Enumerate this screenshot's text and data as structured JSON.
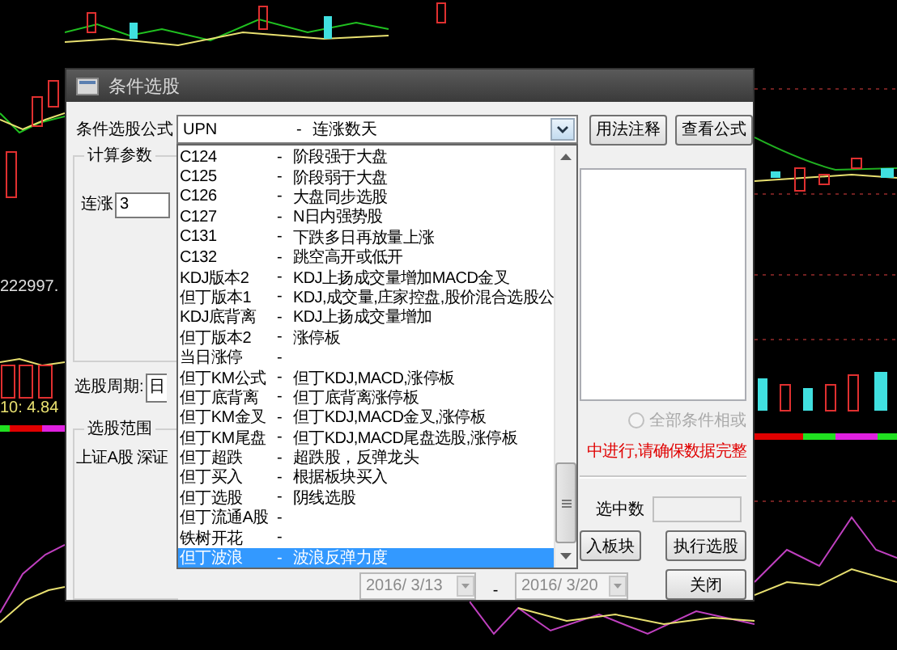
{
  "chart_left": {
    "price_label": "222997.",
    "indicator_label": "10: 4.84"
  },
  "dialog": {
    "title": "条件选股",
    "formula_label": "条件选股公式",
    "formula_combo": {
      "code": "UPN",
      "separator": "-",
      "name": "连涨数天"
    },
    "buttons_top": [
      "用法注释",
      "查看公式"
    ],
    "dropdown_items": [
      {
        "code": "C124",
        "dash": "-",
        "desc": "阶段强于大盘",
        "selected": false
      },
      {
        "code": "C125",
        "dash": "-",
        "desc": "阶段弱于大盘",
        "selected": false
      },
      {
        "code": "C126",
        "dash": "-",
        "desc": "大盘同步选股",
        "selected": false
      },
      {
        "code": "C127",
        "dash": "-",
        "desc": "N日内强势股",
        "selected": false
      },
      {
        "code": "C131",
        "dash": "-",
        "desc": "下跌多日再放量上涨",
        "selected": false
      },
      {
        "code": "C132",
        "dash": "-",
        "desc": "跳空高开或低开",
        "selected": false
      },
      {
        "code": "KDJ版本2",
        "dash": "-",
        "desc": "KDJ上扬成交量增加MACD金叉",
        "selected": false
      },
      {
        "code": "但丁版本1",
        "dash": "-",
        "desc": "KDJ,成交量,庄家控盘,股价混合选股公",
        "selected": false
      },
      {
        "code": "KDJ底背离",
        "dash": "-",
        "desc": "KDJ上扬成交量增加",
        "selected": false
      },
      {
        "code": "但丁版本2",
        "dash": "-",
        "desc": "涨停板",
        "selected": false
      },
      {
        "code": "当日涨停",
        "dash": "-",
        "selected": false
      },
      {
        "code": "但丁KM公式",
        "dash": "-",
        "desc": "但丁KDJ,MACD,涨停板",
        "selected": false
      },
      {
        "code": "但丁底背离",
        "dash": "-",
        "desc": "但丁底背离涨停板",
        "selected": false
      },
      {
        "code": "但丁KM金叉",
        "dash": "-",
        "desc": "但丁KDJ,MACD金叉,涨停板",
        "selected": false
      },
      {
        "code": "但丁KM尾盘",
        "dash": "-",
        "desc": "但丁KDJ,MACD尾盘选股,涨停板",
        "selected": false
      },
      {
        "code": "但丁超跌",
        "dash": "-",
        "desc": "超跌股，反弹龙头",
        "selected": false
      },
      {
        "code": "但丁买入",
        "dash": "-",
        "desc": "根据板块买入",
        "selected": false
      },
      {
        "code": "但丁选股",
        "dash": "-",
        "desc": "阴线选股",
        "selected": false
      },
      {
        "code": "但丁流通A股",
        "dash": "-",
        "selected": false
      },
      {
        "code": "铁树开花",
        "dash": "-",
        "selected": false
      },
      {
        "code": "但丁波浪",
        "dash": "-",
        "desc": "波浪反弹力度",
        "selected": true
      }
    ],
    "params_group": {
      "title": "计算参数",
      "param_label": "连涨",
      "param_value": "3"
    },
    "period": {
      "label": "选股周期:",
      "value": "日"
    },
    "range_group": {
      "title": "选股范围",
      "text": "上证A股 深证"
    },
    "or_option": {
      "label": "全部条件相或",
      "selected": false,
      "disabled": true
    },
    "warning": "中进行,请确保数据完整",
    "selected_count": {
      "label": "选中数"
    },
    "date_from": "2016/ 3/13",
    "date_separator": "-",
    "date_to": "2016/ 3/20",
    "buttons_bottom": [
      "入板块",
      "执行选股",
      "关闭"
    ]
  }
}
